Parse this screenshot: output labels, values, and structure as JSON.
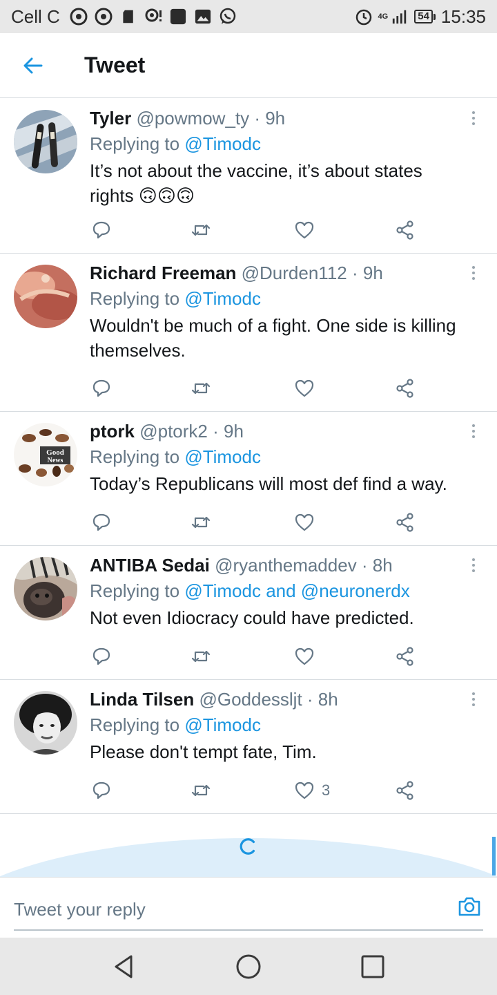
{
  "status_bar": {
    "carrier": "Cell C",
    "network": "4G",
    "battery": "54",
    "time": "15:35"
  },
  "header": {
    "title": "Tweet"
  },
  "tweets": [
    {
      "name": "Tyler",
      "handle": "@powmow_ty · 9h",
      "replying_prefix": "Replying to ",
      "mentions": "@Timodc",
      "text": "It’s not about the vaccine, it’s about states rights 🙃🙃🙃",
      "like_count": "",
      "avatar": "ski-photo"
    },
    {
      "name": "Richard Freeman",
      "handle": "@Durden112 · 9h",
      "replying_prefix": "Replying to ",
      "mentions": "@Timodc",
      "text": "Wouldn't be much of a fight. One side is killing themselves.",
      "like_count": "",
      "avatar": "painting-photo"
    },
    {
      "name": "ptork",
      "handle": "@ptork2 · 9h",
      "replying_prefix": "Replying to ",
      "mentions": "@Timodc",
      "text": "Today’s Republicans  will most def find a way.",
      "like_count": "",
      "avatar": "good-news-logo"
    },
    {
      "name": "ANTIBA Sedai",
      "handle": "@ryanthemaddev · 8h",
      "replying_prefix": "Replying to ",
      "mentions": "@Timodc and @neuronerdx",
      "text": "Not even Idiocracy could have predicted.",
      "like_count": "",
      "avatar": "dog-photo"
    },
    {
      "name": "Linda Tilsen",
      "handle": "@Goddessljt · 8h",
      "replying_prefix": "Replying to ",
      "mentions": "@Timodc",
      "text": "Please don't tempt fate, Tim.",
      "like_count": "3",
      "avatar": "portrait-photo"
    }
  ],
  "composer": {
    "placeholder": "Tweet your reply"
  },
  "logo_text": {
    "good": "Good",
    "news": "News"
  },
  "colors": {
    "accent": "#1b95e0",
    "muted": "#657786",
    "text": "#14171a",
    "divider": "#d8dde1"
  }
}
